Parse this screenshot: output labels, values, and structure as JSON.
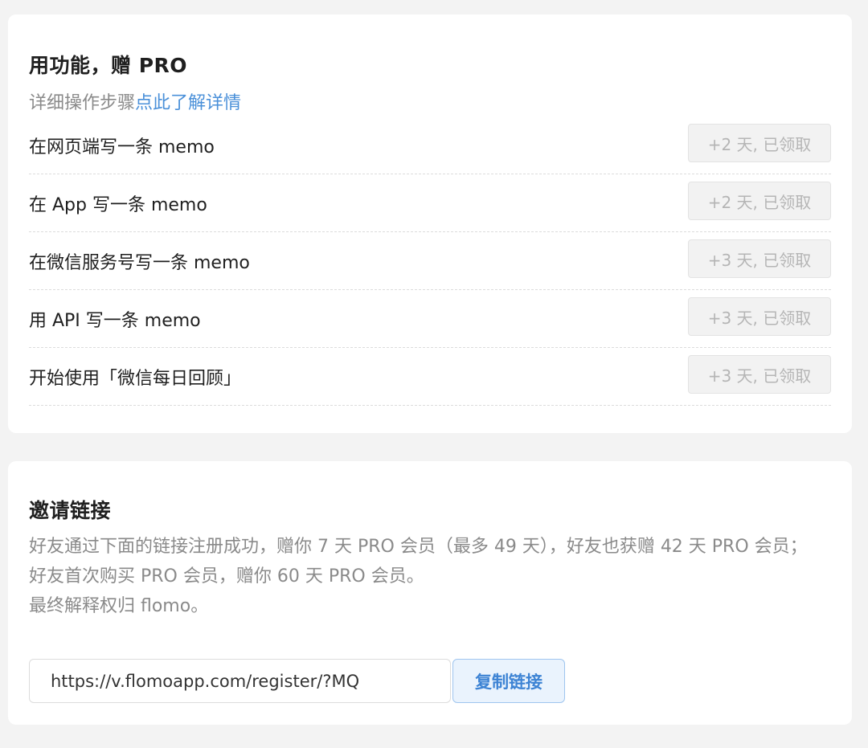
{
  "tasks_card": {
    "title": "用功能，赠 PRO",
    "subtitle_prefix": "详细操作步骤",
    "subtitle_link": "点此了解详情",
    "tasks": [
      {
        "label": "在网页端写一条 memo",
        "button": "+2 天, 已领取"
      },
      {
        "label": "在 App 写一条 memo",
        "button": "+2 天, 已领取"
      },
      {
        "label": "在微信服务号写一条 memo",
        "button": "+3 天, 已领取"
      },
      {
        "label": "用 API 写一条 memo",
        "button": "+3 天, 已领取"
      },
      {
        "label": "开始使用「微信每日回顾」",
        "button": "+3 天, 已领取"
      }
    ]
  },
  "invite_card": {
    "title": "邀请链接",
    "desc_line1": "好友通过下面的链接注册成功，赠你 7 天 PRO 会员（最多 49 天），好友也获赠 42 天 PRO 会员；",
    "desc_line2": "好友首次购买 PRO 会员，赠你 60 天 PRO 会员。",
    "desc_line3": "最终解释权归 flomo。",
    "link_value": "https://v.flomoapp.com/register/?MQ",
    "copy_label": "复制链接"
  },
  "colors": {
    "link": "#4a90d9",
    "button_disabled_bg": "#f2f2f2",
    "copy_button_bg": "#eaf3fd"
  }
}
